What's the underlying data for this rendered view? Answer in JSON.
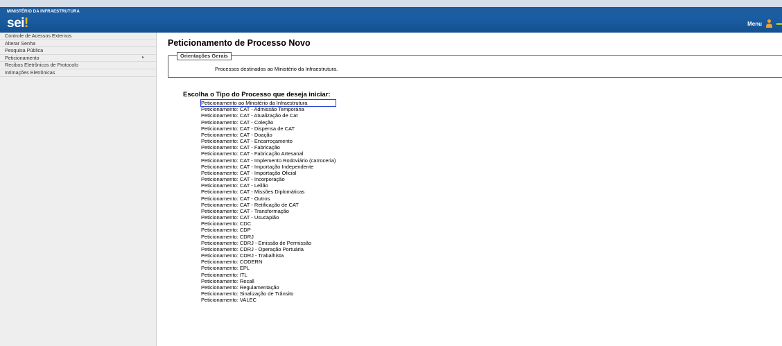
{
  "header": {
    "ministry": "MINISTÉRIO DA INFRAESTRUTURA",
    "logo_text": "sei",
    "logo_dot": "!",
    "menu_label": "Menu",
    "user_icon": "user-icon",
    "exit_icon": "exit-icon"
  },
  "sidebar": {
    "items": [
      {
        "label": "Controle de Acessos Externos",
        "has_submenu": false
      },
      {
        "label": "Alterar Senha",
        "has_submenu": false
      },
      {
        "label": "Pesquisa Pública",
        "has_submenu": false
      },
      {
        "label": "Peticionamento",
        "has_submenu": true,
        "arrow": "▸"
      },
      {
        "label": "Recibos Eletrônicos de Protocolo",
        "has_submenu": false
      },
      {
        "label": "Intimações Eletrônicas",
        "has_submenu": false
      }
    ]
  },
  "main": {
    "title": "Peticionamento de Processo Novo",
    "orientacoes": {
      "legend": "Orientações Gerais",
      "text": "Processos destinados ao Ministério da Infraestrutura."
    },
    "choose_label": "Escolha o Tipo do Processo que deseja iniciar:",
    "selected_index": 0,
    "process_types": [
      "Peticionamento ao Ministério da Infraestrutura",
      "Peticionamento: CAT - Admissão Temporária",
      "Peticionamento: CAT - Atualização de Cat",
      "Peticionamento: CAT - Coleção",
      "Peticionamento: CAT - Dispensa de CAT",
      "Peticionamento: CAT - Doação",
      "Peticionamento: CAT - Encarroçamento",
      "Peticionamento: CAT - Fabricação",
      "Peticionamento: CAT - Fabricação Artesanal",
      "Peticionamento: CAT - Implemento Rodoviário (carroceria)",
      "Peticionamento: CAT - Importação Independente",
      "Peticionamento: CAT - Importação Oficial",
      "Peticionamento: CAT - Incorporação",
      "Peticionamento: CAT - Leilão",
      "Peticionamento: CAT - Missões Diplomáticas",
      "Peticionamento: CAT - Outros",
      "Peticionamento: CAT - Retificação de CAT",
      "Peticionamento: CAT - Transformação",
      "Peticionamento: CAT - Usucapião",
      "Peticionamento: CDC",
      "Peticionamento: CDP",
      "Peticionamento: CDRJ",
      "Peticionamento: CDRJ - Emissão de Permissão",
      "Peticionamento: CDRJ - Operação Portuária",
      "Peticionamento: CDRJ - Trabalhista",
      "Peticionamento: CODERN",
      "Peticionamento: EPL",
      "Peticionamento: ITL",
      "Peticionamento: Recall",
      "Peticionamento: Regulamentação",
      "Peticionamento: Sinalização de Trânsito",
      "Peticionamento: VALEC"
    ]
  },
  "colors": {
    "header_blue": "#1b5da3",
    "selection_border": "#2b3fcf",
    "logo_dot": "#f0c000"
  }
}
